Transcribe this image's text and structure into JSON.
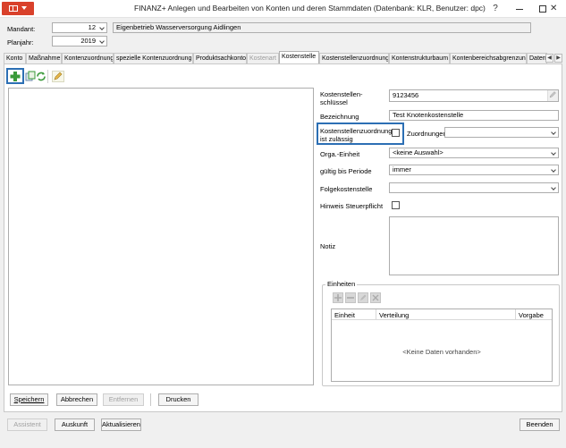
{
  "window": {
    "title": "FINANZ+ Anlegen und Bearbeiten von Konten und deren Stammdaten (Datenbank: KLR, Benutzer: dpc)",
    "help": "?"
  },
  "header": {
    "mandant_label": "Mandant:",
    "mandant_value": "12",
    "mandant_name": "Eigenbetrieb Wasserversorgung Aidlingen",
    "planjahr_label": "Planjahr:",
    "planjahr_value": "2019"
  },
  "tabs": [
    {
      "label": "Konto"
    },
    {
      "label": "Maßnahme"
    },
    {
      "label": "Kontenzuordnung"
    },
    {
      "label": "spezielle Kontenzuordnung"
    },
    {
      "label": "Produktsachkonto"
    },
    {
      "label": "Kostenart"
    },
    {
      "label": "Kostenstelle"
    },
    {
      "label": "Kostenstellenzuordnung"
    },
    {
      "label": "Kontenstrukturbaum"
    },
    {
      "label": "Kontenbereichsabgrenzung"
    },
    {
      "label": "Daten"
    }
  ],
  "form": {
    "schluessel_label_1": "Kostenstellen-",
    "schluessel_label_2": "schlüssel",
    "schluessel_value": "9123456",
    "bezeichnung_label": "Bezeichnung",
    "bezeichnung_value": "Test Knotenkostenstelle",
    "zuordnung_label_1": "Kostenstellenzuordnung",
    "zuordnung_label_2": "ist zulässig",
    "zuordnungen_label": "Zuordnungen",
    "zuordnungen_value": "",
    "orga_label": "Orga.-Einheit",
    "orga_value": "<keine Auswahl>",
    "periode_label": "gültig bis Periode",
    "periode_value": "immer",
    "folge_label": "Folgekostenstelle",
    "folge_value": "",
    "steuer_label": "Hinweis Steuerpflicht",
    "notiz_label": "Notiz",
    "notiz_value": ""
  },
  "einheiten": {
    "title": "Einheiten",
    "columns": [
      "Einheit",
      "Verteilung",
      "Vorgabe"
    ],
    "empty": "<Keine Daten vorhanden>"
  },
  "buttons": {
    "speichern": "Speichern",
    "abbrechen": "Abbrechen",
    "entfernen": "Entfernen",
    "drucken": "Drucken",
    "assistent": "Assistent",
    "auskunft": "Auskunft",
    "aktualisieren": "Aktualisieren",
    "beenden": "Beenden"
  },
  "colors": {
    "accent": "#d9412b",
    "highlight": "#2c6fb4",
    "add_icon": "#3a9a3a"
  }
}
